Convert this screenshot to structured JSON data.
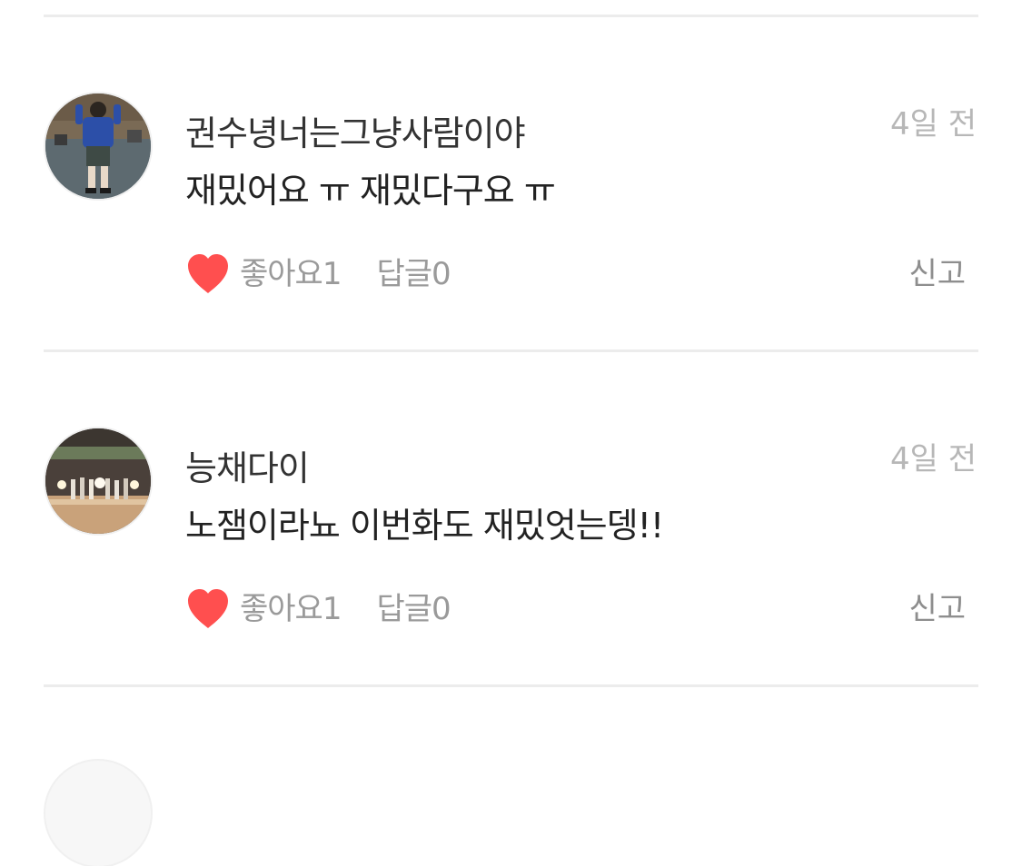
{
  "comments": [
    {
      "nickname": "권수녕너는그냥사람이야",
      "time": "4일 전",
      "text": "재밌어요 ㅠ 재밌다구요 ㅠ",
      "like_label": "좋아요",
      "like_count": "1",
      "reply_label": "답글",
      "reply_count": "0",
      "report_label": "신고",
      "avatar": "person-standing-outdoors"
    },
    {
      "nickname": "능채다이",
      "time": "4일 전",
      "text": "노잼이라뇨 이번화도 재밌엇는뎅!!",
      "like_label": "좋아요",
      "like_count": "1",
      "reply_label": "답글",
      "reply_count": "0",
      "report_label": "신고",
      "avatar": "stage-performance"
    }
  ],
  "colors": {
    "heart": "#ff4f4f",
    "divider": "#ececec",
    "muted_text": "#9a9a9a",
    "time_text": "#b7b7b7"
  },
  "icons": {
    "like": "heart-icon"
  }
}
